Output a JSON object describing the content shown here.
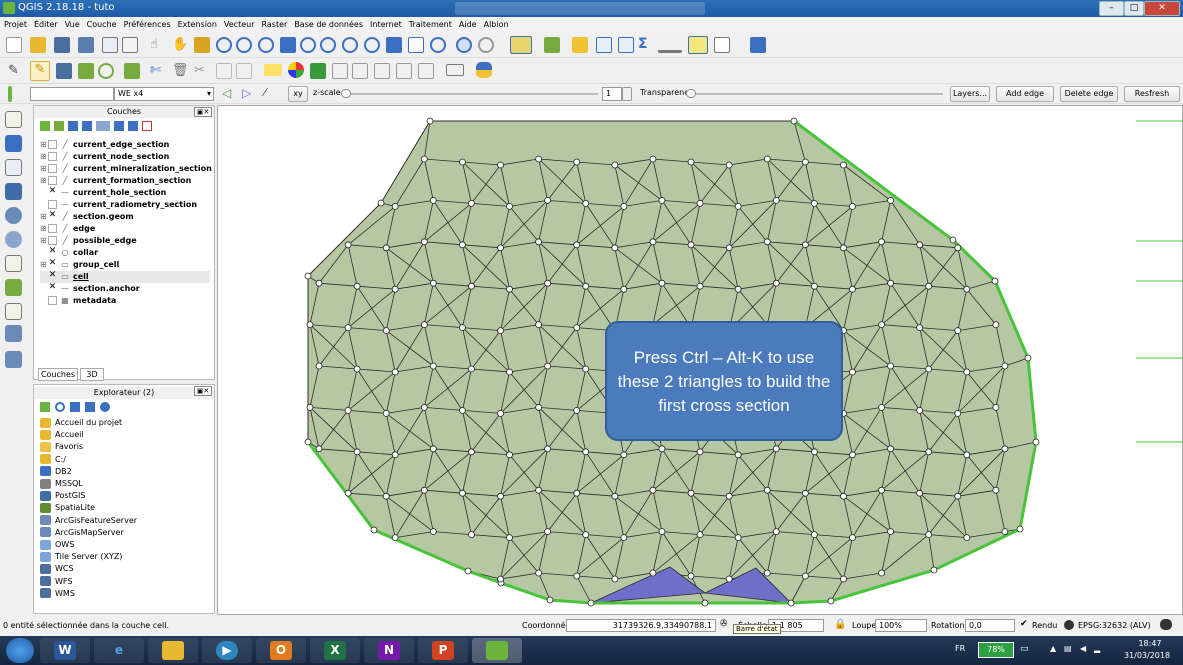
{
  "window": {
    "title": "QGIS 2.18.18 - tuto",
    "minimize": "–",
    "maximize": "□",
    "close": "✕"
  },
  "menu": [
    "Projet",
    "Éditer",
    "Vue",
    "Couche",
    "Préférences",
    "Extension",
    "Vecteur",
    "Raster",
    "Base de données",
    "Internet",
    "Traitement",
    "Aide",
    "Albion"
  ],
  "plugin_toolbar": {
    "layer_select": "",
    "line_select": "WE x4",
    "xy_label": "xy",
    "zscale_label": "z-scale",
    "zscale_value": "1",
    "transparency_label": "Transparency",
    "layers_button": "Layers...",
    "add_edge_button": "Add edge",
    "delete_edge_button": "Delete edge",
    "refresh_button": "Resfresh"
  },
  "layers_panel": {
    "title": "Couches",
    "layers": [
      {
        "name": "current_edge_section",
        "checked": false,
        "expand": "⊞",
        "icon": "line"
      },
      {
        "name": "current_node_section",
        "checked": false,
        "expand": "⊞",
        "icon": "line"
      },
      {
        "name": "current_mineralization_section",
        "checked": false,
        "expand": "⊞",
        "icon": "line"
      },
      {
        "name": "current_formation_section",
        "checked": false,
        "expand": "⊞",
        "icon": "line"
      },
      {
        "name": "current_hole_section",
        "checked": true,
        "expand": "",
        "icon": "line-solid"
      },
      {
        "name": "current_radiometry_section",
        "checked": false,
        "expand": "",
        "icon": "line-solid"
      },
      {
        "name": "section.geom",
        "checked": true,
        "expand": "⊞",
        "icon": "line"
      },
      {
        "name": "edge",
        "checked": false,
        "expand": "⊞",
        "icon": "line"
      },
      {
        "name": "possible_edge",
        "checked": false,
        "expand": "⊞",
        "icon": "line"
      },
      {
        "name": "collar",
        "checked": true,
        "expand": "",
        "icon": "point"
      },
      {
        "name": "group_cell",
        "checked": true,
        "expand": "⊞",
        "icon": "polygon"
      },
      {
        "name": "cell",
        "checked": true,
        "expand": "",
        "icon": "polygon"
      },
      {
        "name": "section.anchor",
        "checked": true,
        "expand": "",
        "icon": "line-solid"
      },
      {
        "name": "metadata",
        "checked": false,
        "expand": "",
        "icon": "table"
      }
    ],
    "tabs": [
      "Couches",
      "3D"
    ]
  },
  "browser_panel": {
    "title": "Explorateur (2)",
    "items": [
      {
        "name": "Accueil du projet",
        "color": "#e8b930"
      },
      {
        "name": "Accueil",
        "color": "#e8b930"
      },
      {
        "name": "Favoris",
        "color": "#f0c24a"
      },
      {
        "name": "C:/",
        "color": "#e8b930"
      },
      {
        "name": "DB2",
        "color": "#3a6fc2"
      },
      {
        "name": "MSSQL",
        "color": "#7f7f7f"
      },
      {
        "name": "PostGIS",
        "color": "#3f6ea6"
      },
      {
        "name": "SpatiaLite",
        "color": "#5e8c2e"
      },
      {
        "name": "ArcGisFeatureServer",
        "color": "#6a8ab8"
      },
      {
        "name": "ArcGisMapServer",
        "color": "#6a8ab8"
      },
      {
        "name": "OWS",
        "color": "#7fa6d6"
      },
      {
        "name": "Tile Server (XYZ)",
        "color": "#7fa6d6"
      },
      {
        "name": "WCS",
        "color": "#4d6f9e"
      },
      {
        "name": "WFS",
        "color": "#4d6f9e"
      },
      {
        "name": "WMS",
        "color": "#4d6f9e"
      }
    ]
  },
  "map": {
    "callout_text": "Press Ctrl – Alt-K to use these 2 triangles to build the first cross section",
    "colors": {
      "fill": "#b6c8a3",
      "edge": "#2b2b2b",
      "section": "#47c43a",
      "highlight": "#6f6fc9",
      "callout": "#4b7bbd"
    }
  },
  "status": {
    "message": "0 entité sélectionnée dans la couche cell.",
    "coord_label": "Coordonnée",
    "coord_value": "31739326.9,33490788.1",
    "scale_label": "Échelle",
    "scale_value": "1:1 805",
    "tooltip": "Barre d'état",
    "magnifier_label": "Loupe",
    "magnifier_value": "100%",
    "rotation_label": "Rotation",
    "rotation_value": "0,0",
    "render_label": "Rendu",
    "crs": "EPSG:32632 (ALV)"
  },
  "taskbar": {
    "language": "FR",
    "battery": "78%",
    "time": "18:47",
    "date": "31/03/2018"
  }
}
